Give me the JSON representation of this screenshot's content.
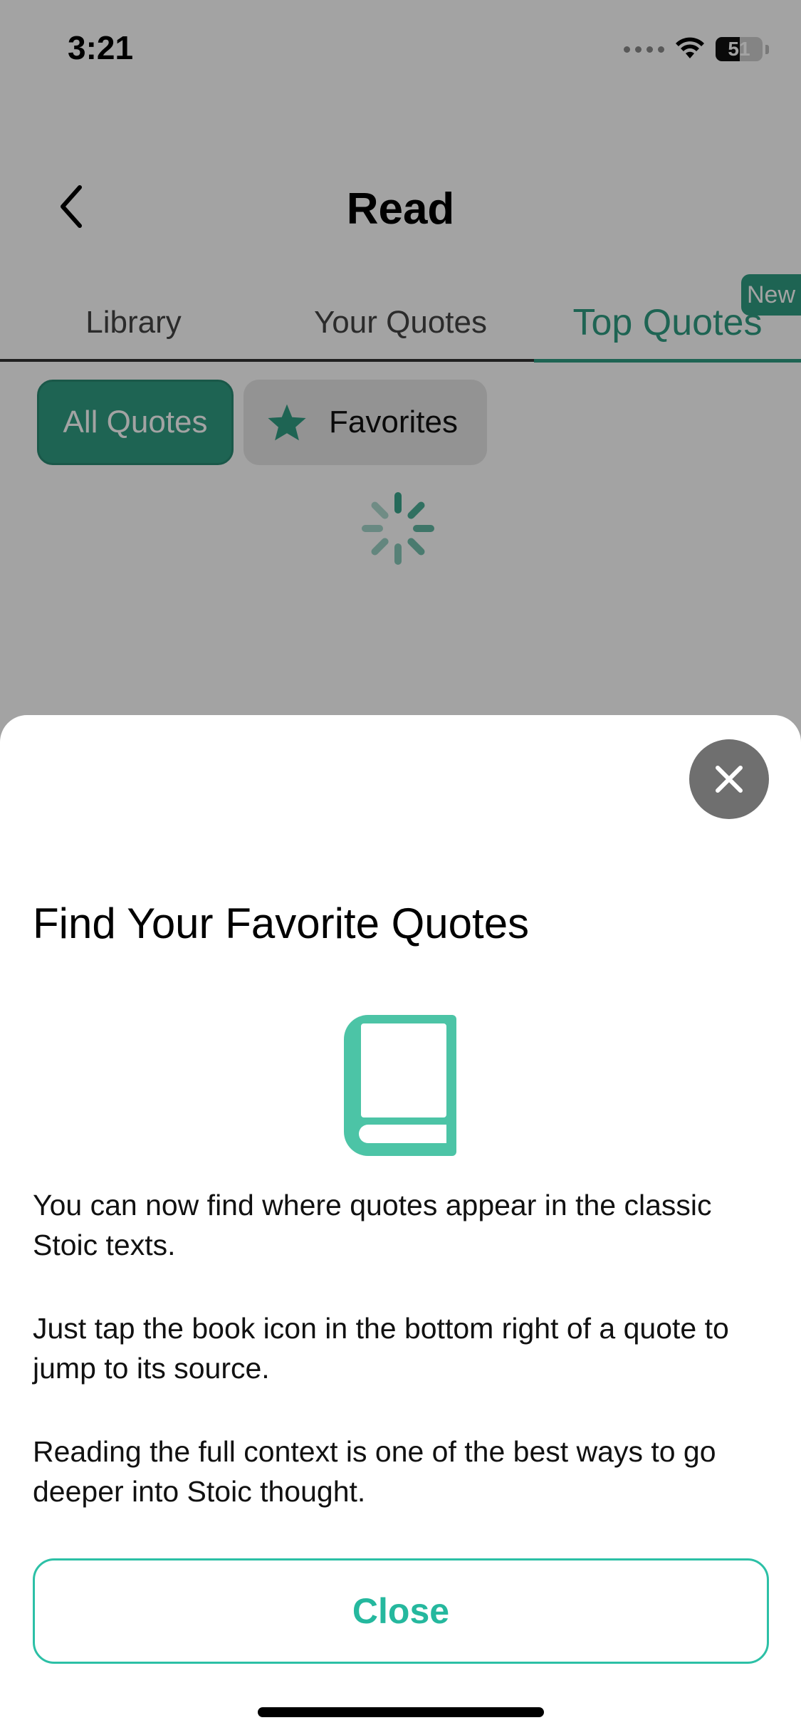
{
  "status_bar": {
    "time": "3:21",
    "battery": "51",
    "battery_level_percent": 51
  },
  "nav": {
    "title": "Read",
    "back_icon": "chevron-left-icon"
  },
  "tabs": [
    {
      "label": "Library",
      "active": false
    },
    {
      "label": "Your Quotes",
      "active": false
    },
    {
      "label": "Top Quotes",
      "active": true
    }
  ],
  "new_badge": "New",
  "chips": {
    "all": "All Quotes",
    "favorites": "Favorites",
    "favorites_icon": "star-icon"
  },
  "sheet": {
    "title": "Find Your Favorite Quotes",
    "icon": "book-icon",
    "paragraphs": [
      "You can now find where quotes appear in the classic Stoic texts.",
      "Just tap the book icon in the bottom right of a quote to jump to its source.",
      "Reading the full context is one of the best ways to go deeper into Stoic thought."
    ],
    "close_button": "Close",
    "dismiss_icon": "close-icon"
  },
  "colors": {
    "accent": "#2f9d83",
    "sheet_accent": "#2cc0a6",
    "book_icon": "#4cc4a6",
    "overlay": "rgba(0,0,0,0.36)"
  }
}
